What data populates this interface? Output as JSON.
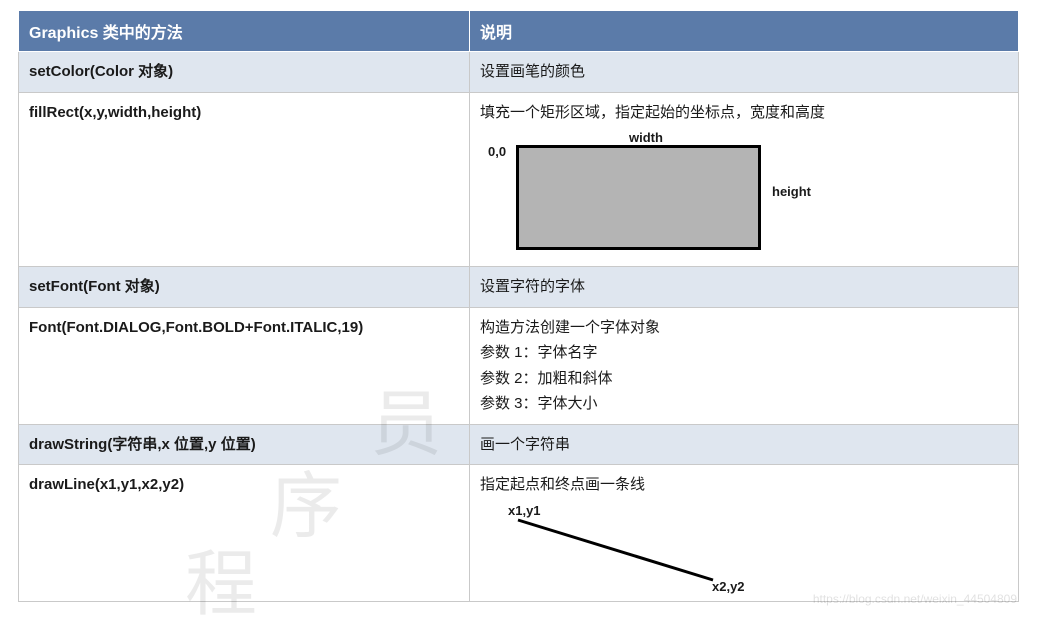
{
  "table": {
    "header": {
      "col1": "Graphics 类中的方法",
      "col2": "说明"
    },
    "rows": [
      {
        "method": "setColor(Color 对象)",
        "desc": "设置画笔的颜色",
        "alt": true
      },
      {
        "method": "fillRect(x,y,width,height)",
        "desc": "填充一个矩形区域，指定起始的坐标点，宽度和高度",
        "diagram": "rect"
      },
      {
        "method": "setFont(Font 对象)",
        "desc": "设置字符的字体",
        "alt": true
      },
      {
        "method": "Font(Font.DIALOG,Font.BOLD+Font.ITALIC,19)",
        "desc_lines": [
          "构造方法创建一个字体对象",
          "参数 1：字体名字",
          "参数 2：加粗和斜体",
          "参数 3：字体大小"
        ]
      },
      {
        "method": "drawString(字符串,x 位置,y 位置)",
        "desc": "画一个字符串",
        "alt": true
      },
      {
        "method": "drawLine(x1,y1,x2,y2)",
        "desc": "指定起点和终点画一条线",
        "diagram": "line"
      }
    ]
  },
  "rect_diagram": {
    "origin": "0,0",
    "width_label": "width",
    "height_label": "height"
  },
  "line_diagram": {
    "p1": "x1,y1",
    "p2": "x2,y2"
  },
  "watermark": {
    "chars": [
      "程",
      "序",
      "员"
    ],
    "source": "https://blog.csdn.net/weixin_44504809"
  }
}
